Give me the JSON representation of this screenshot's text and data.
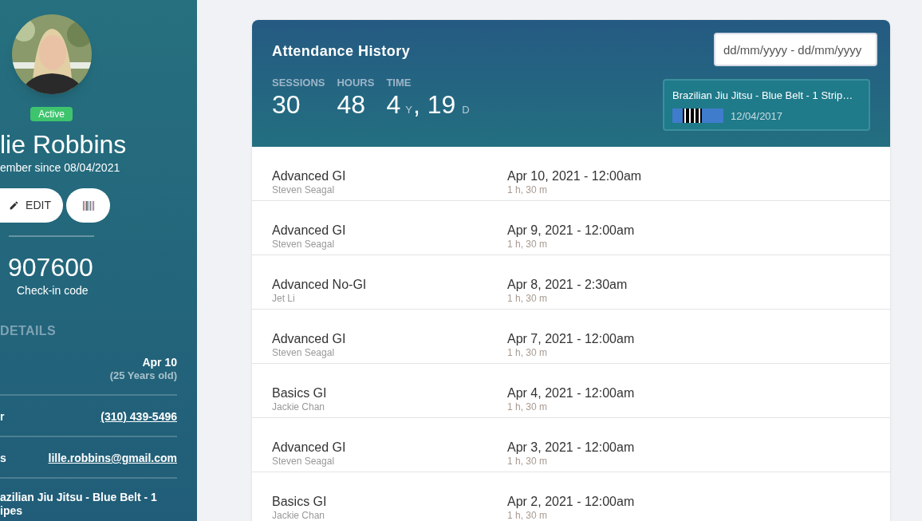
{
  "sidebar": {
    "status_badge": "Active",
    "name": "lie Robbins",
    "member_since": "ember since 08/04/2021",
    "edit_button": "EDIT",
    "checkin_code": "907600",
    "checkin_label": "Check-in code",
    "details_heading": "DETAILS",
    "details": [
      {
        "kind": "date",
        "value": "Apr 10",
        "sub": "(25 Years old)"
      },
      {
        "kind": "link",
        "label": "r",
        "value": "(310) 439-5496"
      },
      {
        "kind": "link",
        "label": "s",
        "value": "lille.robbins@gmail.com"
      }
    ],
    "belt_lines": [
      "azilian Jiu Jitsu - Blue Belt - 1",
      "ipes"
    ]
  },
  "attendance": {
    "title": "Attendance History",
    "date_range": {
      "placeholder": "dd/mm/yyyy - dd/mm/yyyy"
    },
    "stats": [
      {
        "label": "SESSIONS",
        "value": "30"
      },
      {
        "label": "HOURS",
        "value": "48"
      },
      {
        "label": "TIME",
        "value": "4",
        "unit": "Y",
        "value_2": ", 19",
        "unit_2": "D"
      }
    ],
    "belt": {
      "name": "Brazilian Jiu Jitsu - Blue Belt - 1 Strip…",
      "date": "12/04/2017",
      "color": "#3f7ccc"
    },
    "rows": [
      {
        "class": "Advanced GI",
        "instructor": "Steven Seagal",
        "datetime": "Apr 10, 2021 - 12:00am",
        "duration": "1 h, 30 m"
      },
      {
        "class": "Advanced GI",
        "instructor": "Steven Seagal",
        "datetime": "Apr 9, 2021 - 12:00am",
        "duration": "1 h, 30 m"
      },
      {
        "class": "Advanced No-GI",
        "instructor": "Jet Li",
        "datetime": "Apr 8, 2021 - 2:30am",
        "duration": "1 h, 30 m"
      },
      {
        "class": "Advanced GI",
        "instructor": "Steven Seagal",
        "datetime": "Apr 7, 2021 - 12:00am",
        "duration": "1 h, 30 m"
      },
      {
        "class": "Basics GI",
        "instructor": "Jackie Chan",
        "datetime": "Apr 4, 2021 - 12:00am",
        "duration": "1 h, 30 m"
      },
      {
        "class": "Advanced GI",
        "instructor": "Steven Seagal",
        "datetime": "Apr 3, 2021 - 12:00am",
        "duration": "1 h, 30 m"
      },
      {
        "class": "Basics GI",
        "instructor": "Jackie Chan",
        "datetime": "Apr 2, 2021 - 12:00am",
        "duration": "1 h, 30 m"
      }
    ]
  }
}
